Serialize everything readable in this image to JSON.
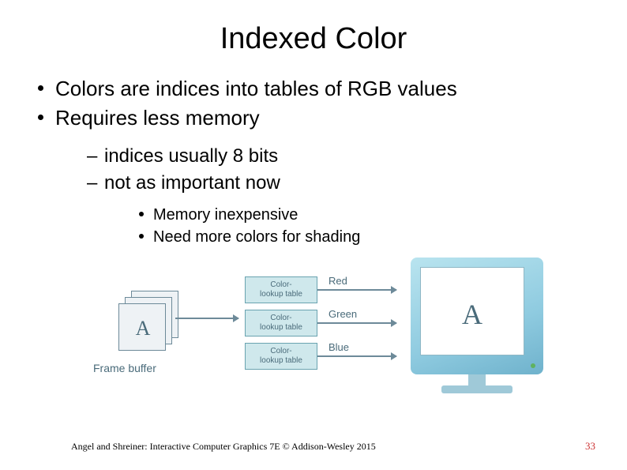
{
  "title": "Indexed Color",
  "bullets": {
    "l1": [
      "Colors are indices into tables of RGB values",
      "Requires less memory"
    ],
    "l2": [
      "indices usually 8 bits",
      "not as important now"
    ],
    "l3": [
      "Memory inexpensive",
      "Need more colors for shading"
    ]
  },
  "diagram": {
    "frame_buffer_label": "Frame buffer",
    "glyph": "A",
    "clt_line1": "Color-",
    "clt_line2": "lookup table",
    "channels": {
      "r": "Red",
      "g": "Green",
      "b": "Blue"
    }
  },
  "footer": "Angel and Shreiner: Interactive Computer Graphics 7E © Addison-Wesley 2015",
  "page_number": "33"
}
